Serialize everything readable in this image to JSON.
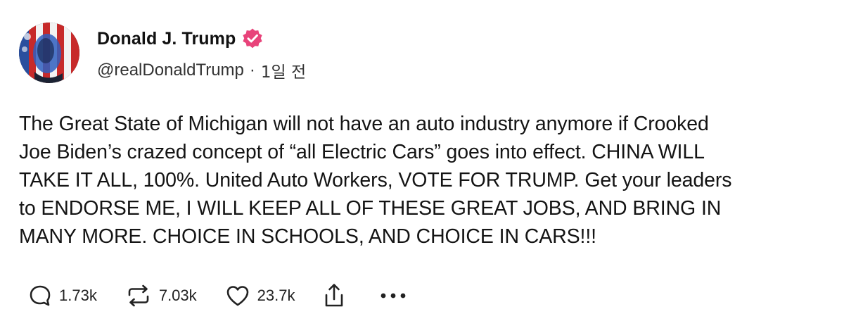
{
  "author": {
    "display_name": "Donald J. Trump",
    "handle": "@realDonaldTrump",
    "separator": "·",
    "timestamp": "1일 전",
    "avatar_icon": "avatar-image",
    "verified_icon": "verified-badge-icon",
    "verified_color": "#e8437a"
  },
  "post": {
    "text": "The Great State of Michigan will not have an auto industry anymore if Crooked\nJoe Biden’s crazed concept of “all Electric Cars” goes into effect. CHINA WILL\nTAKE IT ALL, 100%. United Auto Workers, VOTE FOR TRUMP. Get your leaders\nto ENDORSE ME, I WILL KEEP ALL OF THESE GREAT JOBS, AND BRING IN\nMANY MORE. CHOICE IN SCHOOLS, AND CHOICE IN CARS!!!"
  },
  "actions": {
    "reply": {
      "icon": "reply-icon",
      "count": "1.73k"
    },
    "retruth": {
      "icon": "retruth-icon",
      "count": "7.03k"
    },
    "like": {
      "icon": "heart-icon",
      "count": "23.7k"
    },
    "share": {
      "icon": "share-icon"
    },
    "more": {
      "icon": "more-icon"
    }
  },
  "colors": {
    "text": "#141414",
    "icon": "#222222",
    "background": "#ffffff"
  }
}
